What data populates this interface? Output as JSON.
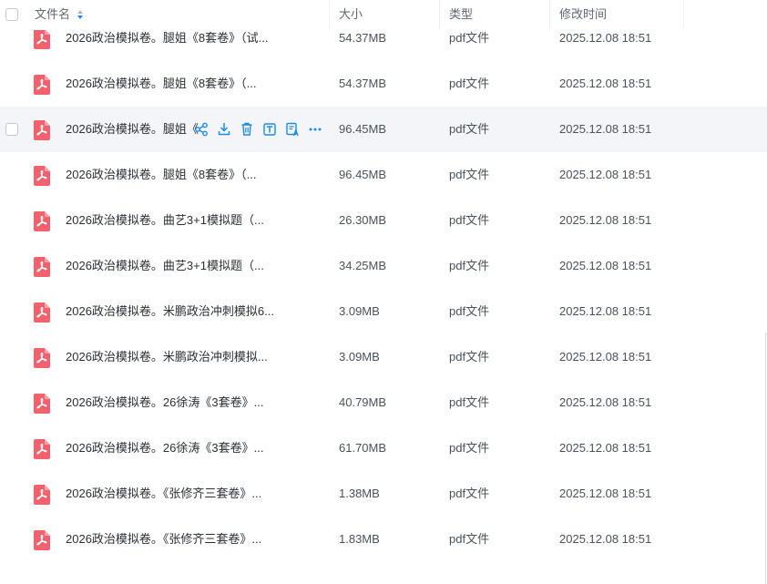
{
  "table": {
    "columns": {
      "name": "文件名",
      "size": "大小",
      "type": "类型",
      "modified": "修改时间"
    },
    "rows": [
      {
        "name": "2026政治模拟卷。腿姐《8套卷》（试...",
        "size": "54.37MB",
        "type": "pdf文件",
        "modified": "2025.12.08 18:51"
      },
      {
        "name": "2026政治模拟卷。腿姐《8套卷》（...",
        "size": "54.37MB",
        "type": "pdf文件",
        "modified": "2025.12.08 18:51"
      },
      {
        "name": "2026政治模拟卷。腿姐《",
        "size": "96.45MB",
        "type": "pdf文件",
        "modified": "2025.12.08 18:51",
        "hovered": true
      },
      {
        "name": "2026政治模拟卷。腿姐《8套卷》（...",
        "size": "96.45MB",
        "type": "pdf文件",
        "modified": "2025.12.08 18:51"
      },
      {
        "name": "2026政治模拟卷。曲艺3+1模拟题（...",
        "size": "26.30MB",
        "type": "pdf文件",
        "modified": "2025.12.08 18:51"
      },
      {
        "name": "2026政治模拟卷。曲艺3+1模拟题（...",
        "size": "34.25MB",
        "type": "pdf文件",
        "modified": "2025.12.08 18:51"
      },
      {
        "name": "2026政治模拟卷。米鹏政治冲刺模拟6...",
        "size": "3.09MB",
        "type": "pdf文件",
        "modified": "2025.12.08 18:51"
      },
      {
        "name": "2026政治模拟卷。米鹏政治冲刺模拟...",
        "size": "3.09MB",
        "type": "pdf文件",
        "modified": "2025.12.08 18:51"
      },
      {
        "name": "2026政治模拟卷。26徐涛《3套卷》...",
        "size": "40.79MB",
        "type": "pdf文件",
        "modified": "2025.12.08 18:51"
      },
      {
        "name": "2026政治模拟卷。26徐涛《3套卷》...",
        "size": "61.70MB",
        "type": "pdf文件",
        "modified": "2025.12.08 18:51"
      },
      {
        "name": "2026政治模拟卷。《张修齐三套卷》...",
        "size": "1.38MB",
        "type": "pdf文件",
        "modified": "2025.12.08 18:51"
      },
      {
        "name": "2026政治模拟卷。《张修齐三套卷》...",
        "size": "1.83MB",
        "type": "pdf文件",
        "modified": "2025.12.08 18:51"
      }
    ],
    "row_actions": [
      "share-icon",
      "download-icon",
      "delete-icon",
      "text-extract-icon",
      "translate-icon",
      "more-icon"
    ]
  },
  "colors": {
    "accent": "#1a8cf0",
    "pdf_icon": "#f4606c",
    "hover_row": "#f4f5f9",
    "header_text": "#5f6673"
  }
}
